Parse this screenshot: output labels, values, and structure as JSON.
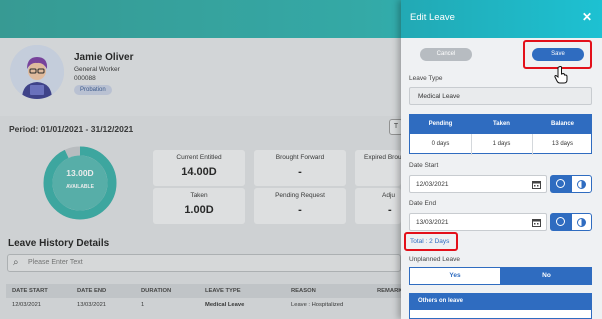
{
  "profile": {
    "name": "Jamie Oliver",
    "role": "General Worker",
    "employee_id": "000088",
    "status_badge": "Probation"
  },
  "period": "Period: 01/01/2021 - 31/12/2021",
  "period_button": "T",
  "donut": {
    "value": "13.00D",
    "label": "AVAILABLE",
    "fraction": 0.93,
    "color": "#3ab0a8"
  },
  "stats": [
    {
      "label": "Current Entitled",
      "value": "14.00D"
    },
    {
      "label": "Brought Forward",
      "value": "-"
    },
    {
      "label": "Expired Brou",
      "value": ""
    },
    {
      "label": "Taken",
      "value": "1.00D"
    },
    {
      "label": "Pending Request",
      "value": "-"
    },
    {
      "label": "Adju",
      "value": "-"
    }
  ],
  "history": {
    "title": "Leave History Details",
    "search_placeholder": "Please Enter Text",
    "columns": [
      "DATE START",
      "DATE END",
      "DURATION",
      "LEAVE TYPE",
      "REASON",
      "REMARKS"
    ],
    "rows": [
      [
        "12/03/2021",
        "13/03/2021",
        "1",
        "Medical Leave",
        "Leave : Hospitalized",
        ""
      ]
    ]
  },
  "edit_leave": {
    "title": "Edit Leave",
    "close_icon": "close-icon",
    "cancel_label": "Cancel",
    "save_label": "Save",
    "leave_type_label": "Leave Type",
    "leave_type_value": "Medical Leave",
    "balance": {
      "headers": [
        "Pending",
        "Taken",
        "Balance"
      ],
      "values": [
        "0 days",
        "1 days",
        "13 days"
      ]
    },
    "date_start_label": "Date Start",
    "date_start_value": "12/03/2021",
    "date_end_label": "Date End",
    "date_end_value": "13/03/2021",
    "total": "Total : 2 Days",
    "unplanned_label": "Unplanned Leave",
    "yes_label": "Yes",
    "no_label": "No",
    "others_title": "Others on leave"
  },
  "colors": {
    "accent": "#2f6cc0",
    "header": "#1dc1d2",
    "highlight": "#e3101a"
  }
}
